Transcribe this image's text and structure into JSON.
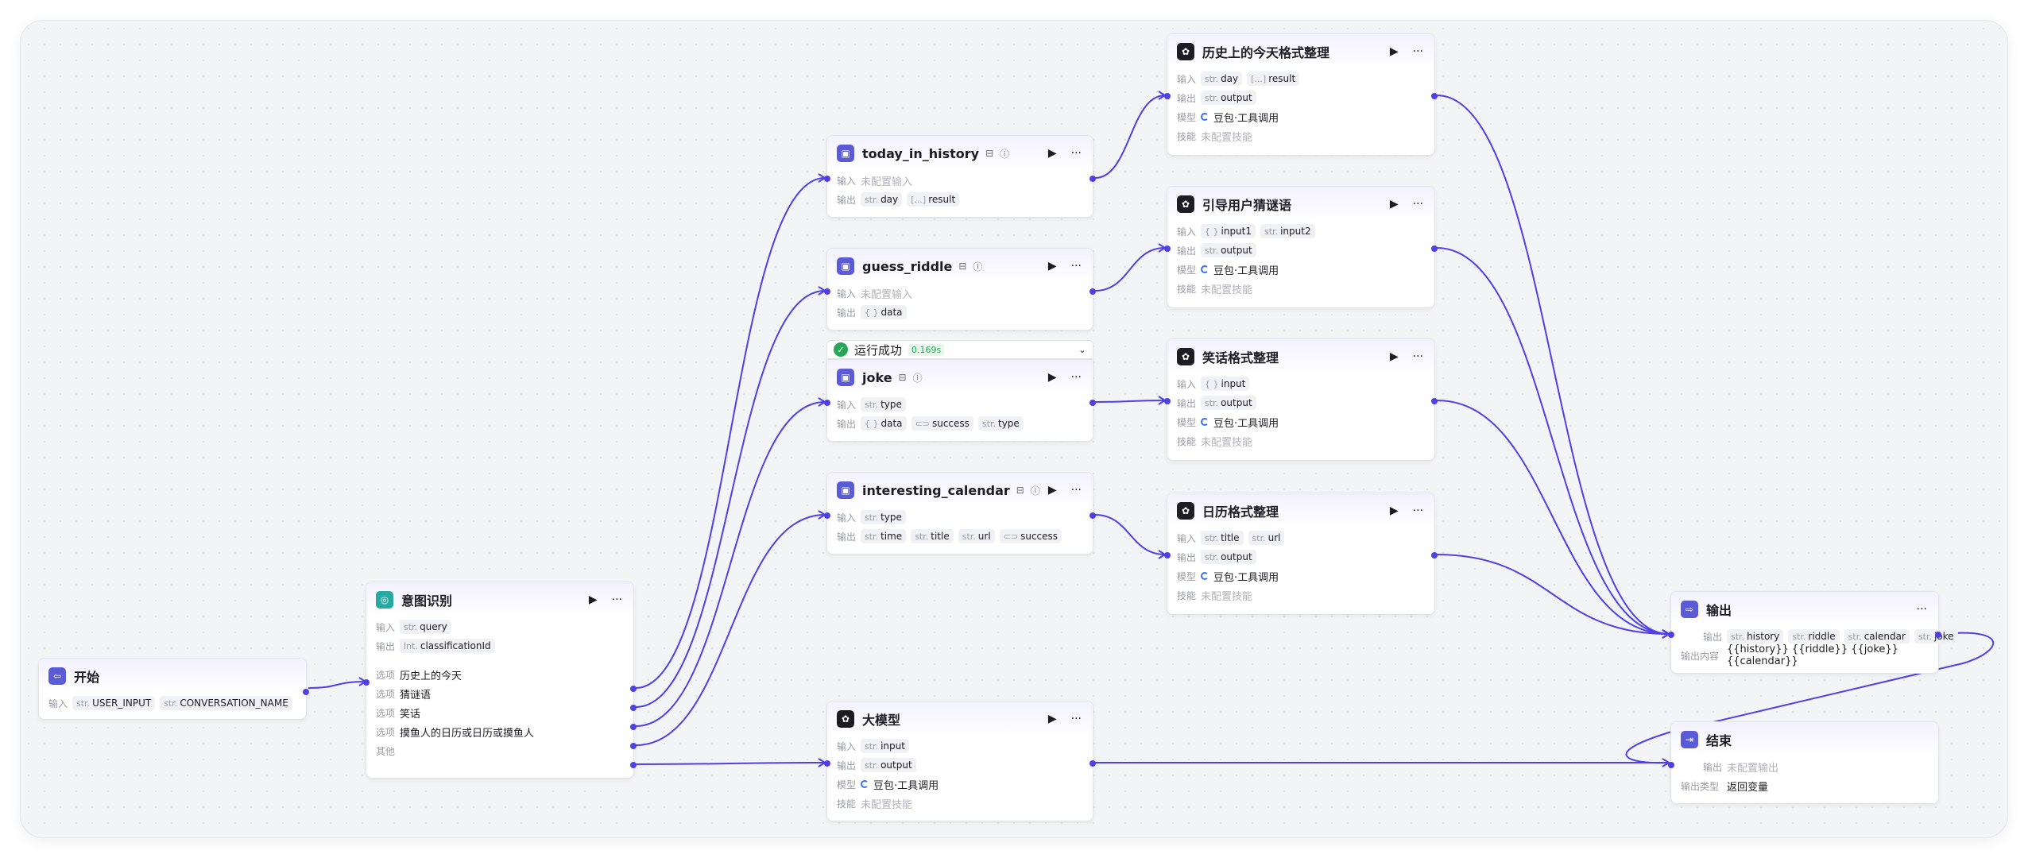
{
  "nodes": {
    "start": {
      "title": "开始",
      "input_label": "输入",
      "vars": [
        {
          "t": "str.",
          "n": "USER_INPUT"
        },
        {
          "t": "str.",
          "n": "CONVERSATION_NAME"
        }
      ]
    },
    "intent": {
      "title": "意图识别",
      "input_label": "输入",
      "output_label": "输出",
      "input": {
        "t": "str.",
        "n": "query"
      },
      "output": {
        "t": "int.",
        "n": "classificationId"
      },
      "option_label": "选项",
      "options": [
        "历史上的今天",
        "猜谜语",
        "笑话",
        "摸鱼人的日历或日历或摸鱼人"
      ],
      "other_label": "其他"
    },
    "today_in_history": {
      "title": "today_in_history",
      "input_label": "输入",
      "input_text": "未配置输入",
      "output_label": "输出",
      "outputs": [
        {
          "t": "str.",
          "n": "day"
        },
        {
          "t": "[...]",
          "n": "result"
        }
      ]
    },
    "guess_riddle": {
      "title": "guess_riddle",
      "input_label": "输入",
      "input_text": "未配置输入",
      "output_label": "输出",
      "outputs": [
        {
          "t": "{ }",
          "n": "data"
        }
      ]
    },
    "run_status": {
      "text": "运行成功",
      "time": "0.169s"
    },
    "joke": {
      "title": "joke",
      "input_label": "输入",
      "inputs": [
        {
          "t": "str.",
          "n": "type"
        }
      ],
      "output_label": "输出",
      "outputs": [
        {
          "t": "{ }",
          "n": "data"
        },
        {
          "t": "⊂⊃",
          "n": "success"
        },
        {
          "t": "str.",
          "n": "type"
        }
      ]
    },
    "interesting_calendar": {
      "title": "interesting_calendar",
      "input_label": "输入",
      "inputs": [
        {
          "t": "str.",
          "n": "type"
        }
      ],
      "output_label": "输出",
      "outputs": [
        {
          "t": "str.",
          "n": "time"
        },
        {
          "t": "str.",
          "n": "title"
        },
        {
          "t": "str.",
          "n": "url"
        },
        {
          "t": "⊂⊃",
          "n": "success"
        }
      ]
    },
    "llm": {
      "title": "大模型",
      "input_label": "输入",
      "input": {
        "t": "str.",
        "n": "input"
      },
      "output_label": "输出",
      "output": {
        "t": "str.",
        "n": "output"
      },
      "model_label": "模型",
      "model": "豆包·工具调用",
      "skill_label": "技能",
      "skill": "未配置技能"
    },
    "history_fmt": {
      "title": "历史上的今天格式整理",
      "input_label": "输入",
      "inputs": [
        {
          "t": "str.",
          "n": "day"
        },
        {
          "t": "[...]",
          "n": "result"
        }
      ],
      "output_label": "输出",
      "output": {
        "t": "str.",
        "n": "output"
      },
      "model_label": "模型",
      "model": "豆包·工具调用",
      "skill_label": "技能",
      "skill": "未配置技能"
    },
    "riddle_fmt": {
      "title": "引导用户猜谜语",
      "input_label": "输入",
      "inputs": [
        {
          "t": "{ }",
          "n": "input1"
        },
        {
          "t": "str.",
          "n": "input2"
        }
      ],
      "output_label": "输出",
      "output": {
        "t": "str.",
        "n": "output"
      },
      "model_label": "模型",
      "model": "豆包·工具调用",
      "skill_label": "技能",
      "skill": "未配置技能"
    },
    "joke_fmt": {
      "title": "笑话格式整理",
      "input_label": "输入",
      "inputs": [
        {
          "t": "{ }",
          "n": "input"
        }
      ],
      "output_label": "输出",
      "output": {
        "t": "str.",
        "n": "output"
      },
      "model_label": "模型",
      "model": "豆包·工具调用",
      "skill_label": "技能",
      "skill": "未配置技能"
    },
    "calendar_fmt": {
      "title": "日历格式整理",
      "input_label": "输入",
      "inputs": [
        {
          "t": "str.",
          "n": "title"
        },
        {
          "t": "str.",
          "n": "url"
        }
      ],
      "output_label": "输出",
      "output": {
        "t": "str.",
        "n": "output"
      },
      "model_label": "模型",
      "model": "豆包·工具调用",
      "skill_label": "技能",
      "skill": "未配置技能"
    },
    "output": {
      "title": "输出",
      "output_label": "输出",
      "outputs": [
        {
          "t": "str.",
          "n": "history"
        },
        {
          "t": "str.",
          "n": "riddle"
        },
        {
          "t": "str.",
          "n": "calendar"
        },
        {
          "t": "str.",
          "n": "joke"
        }
      ],
      "content_label": "输出内容",
      "content": "{{history}} {{riddle}} {{joke}} {{calendar}}"
    },
    "end": {
      "title": "结束",
      "output_label": "输出",
      "output_text": "未配置输出",
      "type_label": "输出类型",
      "type_value": "返回变量"
    }
  },
  "colors": {
    "edge": "#4e40e5",
    "plugin_icon": "#5b5bd6",
    "intent_icon": "#27a8a0",
    "success": "#2aa55a"
  },
  "icons": {
    "run": "play-icon",
    "more": "more-icon",
    "lock": "lock-icon",
    "info": "info-icon"
  }
}
